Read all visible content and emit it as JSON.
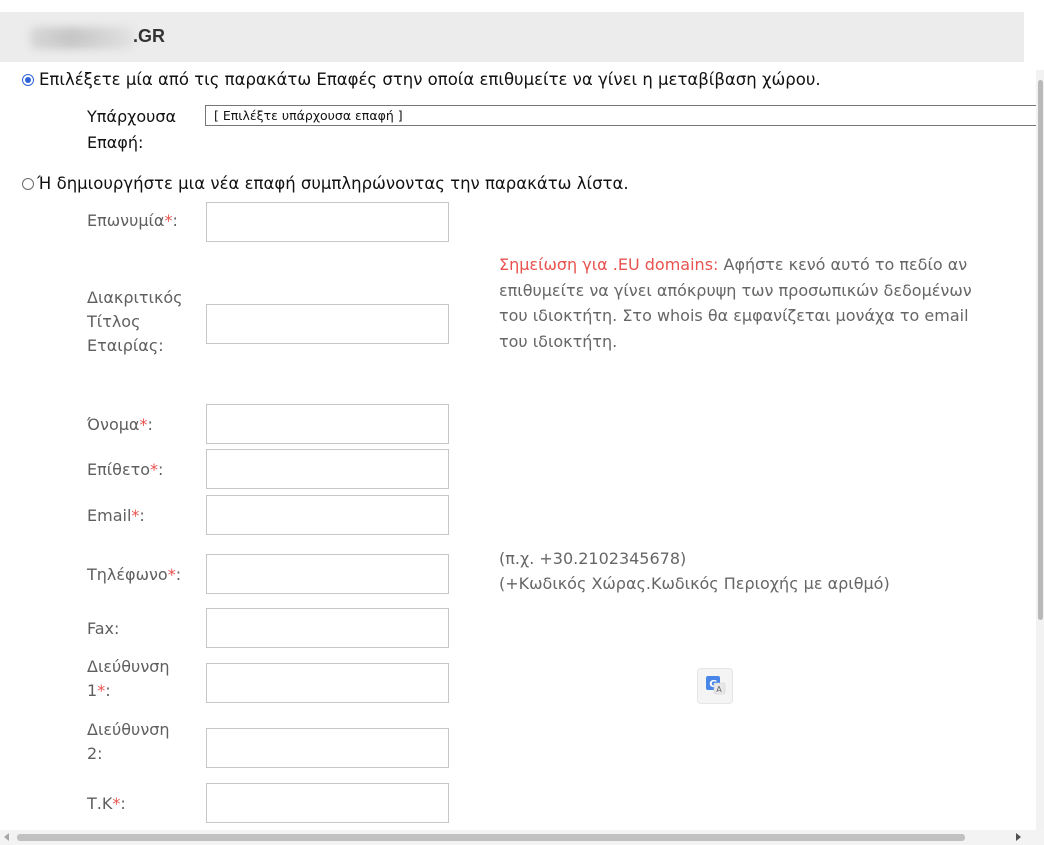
{
  "header": {
    "domain_suffix": ".GR"
  },
  "options": {
    "existing": {
      "label": "Επιλέξετε μία από τις παρακάτω Επαφές στην οποία επιθυμείτε να γίνει η μεταβίβαση χώρου.",
      "checked": true
    },
    "new": {
      "label": "Ή δημιουργήστε μια νέα επαφή συμπληρώνοντας την παρακάτω λίστα.",
      "checked": false
    }
  },
  "existing_contact": {
    "label": "Υπάρχουσα Επαφή:",
    "selected": "[ Επιλέξτε υπάρχουσα επαφή ]"
  },
  "form": {
    "fields": [
      {
        "label": "Επωνυμία",
        "required": true,
        "value": ""
      },
      {
        "label": "Διακριτικός Τίτλος Εταιρίας:",
        "required": false,
        "value": ""
      },
      {
        "label": "Όνομα",
        "required": true,
        "value": ""
      },
      {
        "label": "Επίθετο",
        "required": true,
        "value": ""
      },
      {
        "label": "Email",
        "required": true,
        "value": ""
      },
      {
        "label": "Τηλέφωνο",
        "required": true,
        "value": ""
      },
      {
        "label": "Fax:",
        "required": false,
        "value": ""
      },
      {
        "label": "Διεύθυνση 1",
        "required": true,
        "value": ""
      },
      {
        "label": "Διεύθυνση 2:",
        "required": false,
        "value": ""
      },
      {
        "label": "Τ.Κ",
        "required": true,
        "value": ""
      }
    ],
    "required_mark": "*",
    "colon": ":"
  },
  "note": {
    "highlight": "Σημείωση για .EU domains:",
    "text": " Αφήστε κενό αυτό το πεδίο αν επιθυμείτε να γίνει απόκρυψη των προσωπικών δεδομένων του ιδιοκτήτη. Στο whois θα εμφανίζεται μονάχα το email του ιδιοκτήτη."
  },
  "phone_hint": {
    "example": "(π.χ. +30.2102345678)",
    "format": "(+Κωδικός Χώρας.Κωδικός Περιοχής με αριθμό)"
  },
  "icons": {
    "translate": "google-translate-icon",
    "radio_checked_color": "#2f62d8",
    "required_color": "#e8524f"
  }
}
